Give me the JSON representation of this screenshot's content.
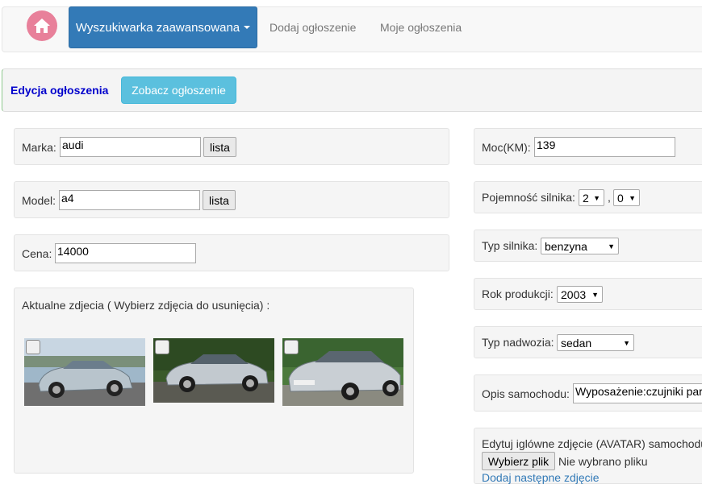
{
  "navbar": {
    "home_icon": "home-icon",
    "search_label": "Wyszukiwarka zaawansowana",
    "add_label": "Dodaj ogłoszenie",
    "my_label": "Moje ogłoszenia"
  },
  "subbar": {
    "title": "Edycja ogłoszenia",
    "view_button": "Zobacz ogłoszenie"
  },
  "form": {
    "brand_label": "Marka:",
    "brand_value": "audi",
    "list_label": "lista",
    "model_label": "Model:",
    "model_value": "a4",
    "price_label": "Cena:",
    "price_value": "14000",
    "photos_label": "Aktualne zdjecia ( Wybierz zdjęcia do usunięcia) :",
    "power_label": "Moc(KM):",
    "power_value": "139",
    "engine_cap_label": "Pojemność silnika:",
    "engine_cap_major": "2",
    "engine_cap_sep": ",",
    "engine_cap_minor": "0",
    "engine_type_label": "Typ silnika:",
    "engine_type_value": "benzyna",
    "year_label": "Rok produkcji:",
    "year_value": "2003",
    "body_label": "Typ nadwozia:",
    "body_value": "sedan",
    "desc_label": "Opis samochodu:",
    "desc_value": "Wyposażenie:czujniki parl",
    "avatar_label": "Edytuj iglówne zdjęcie (AVATAR) samochodu",
    "choose_file": "Wybierz plik",
    "no_file": "Nie wybrano pliku",
    "add_photo_link": "Dodaj następne zdjęcie"
  },
  "colors": {
    "primary": "#337ab7",
    "info": "#5bc0de",
    "home": "#e8809a",
    "title": "#0000cc"
  }
}
